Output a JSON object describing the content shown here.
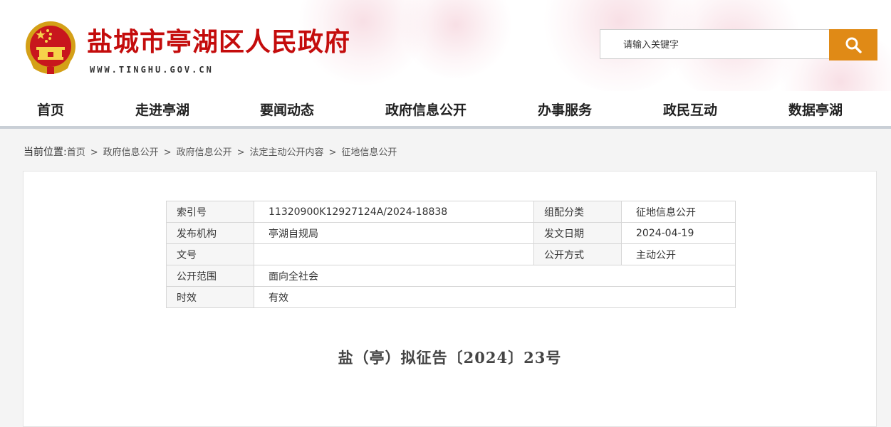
{
  "header": {
    "site_title": "盐城市亭湖区人民政府",
    "site_domain": "WWW.TINGHU.GOV.CN",
    "search_placeholder": "请输入关键字",
    "emblem_icon": "national-emblem-icon",
    "search_icon": "search-icon",
    "colors": {
      "title": "#c40c0c",
      "search_button": "#e08a16"
    }
  },
  "nav": {
    "items": [
      "首页",
      "走进亭湖",
      "要闻动态",
      "政府信息公开",
      "办事服务",
      "政民互动",
      "数据亭湖"
    ]
  },
  "breadcrumb": {
    "label": "当前位置:",
    "items": [
      "首页",
      "政府信息公开",
      "政府信息公开",
      "法定主动公开内容",
      "征地信息公开"
    ],
    "separator": ">"
  },
  "meta": {
    "index_no_label": "索引号",
    "index_no": "11320900K12927124A/2024-18838",
    "category_label": "组配分类",
    "category": "征地信息公开",
    "publisher_label": "发布机构",
    "publisher": "亭湖自规局",
    "date_label": "发文日期",
    "date": "2024-04-19",
    "doc_no_label": "文号",
    "doc_no": "",
    "method_label": "公开方式",
    "method": "主动公开",
    "scope_label": "公开范围",
    "scope": "面向全社会",
    "validity_label": "时效",
    "validity": "有效"
  },
  "document": {
    "title": "盐（亭）拟征告〔2024〕23号"
  }
}
